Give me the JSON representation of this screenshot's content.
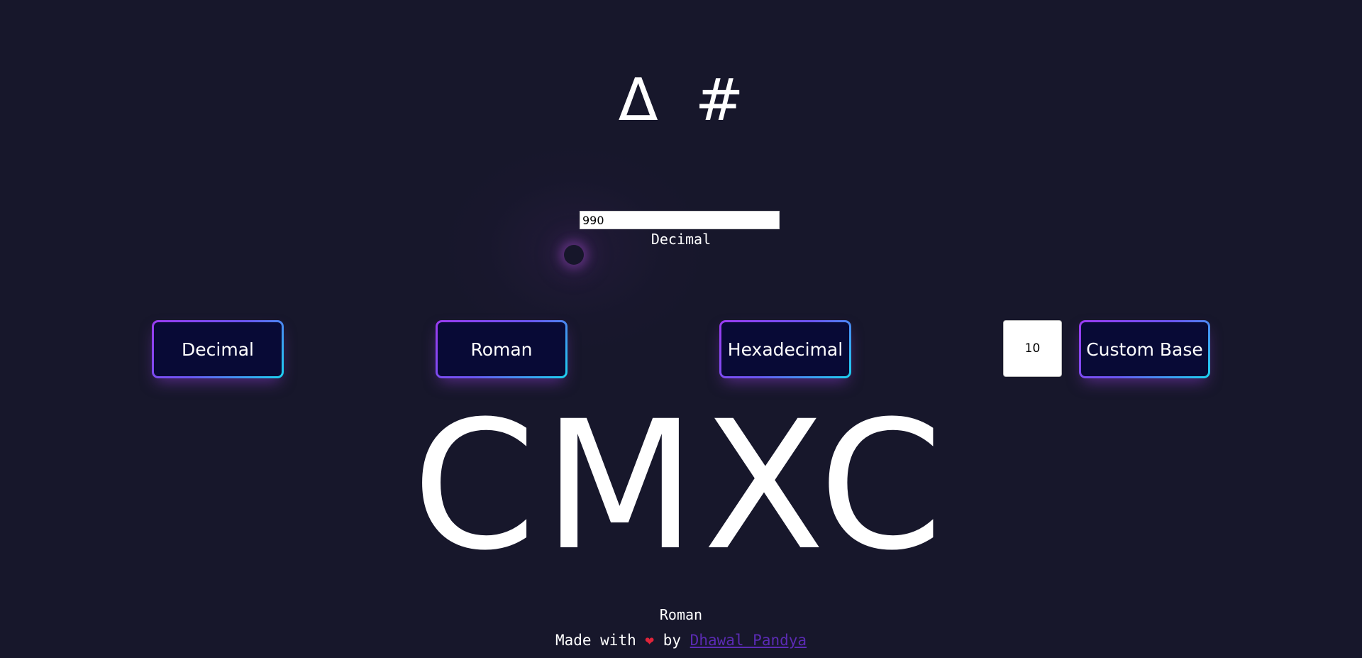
{
  "logo": {
    "delta_symbol": "Δ",
    "hash_symbol": "#"
  },
  "input": {
    "value": "990",
    "type_label": "Decimal"
  },
  "buttons": {
    "decimal": "Decimal",
    "roman": "Roman",
    "hexadecimal": "Hexadecimal",
    "custom_base": "Custom Base"
  },
  "custom_base_input": {
    "value": "10"
  },
  "result": {
    "value": "CMXC",
    "type_label": "Roman"
  },
  "footer": {
    "made_with": "Made with",
    "heart_icon": "heart-icon",
    "by": "by",
    "author_link": "Dhawal Pandya"
  },
  "colors": {
    "background": "#17172b",
    "button_fill": "#080a36",
    "gradient_start": "#9b3bf0",
    "gradient_end": "#1ad3f0",
    "heart": "#e0243a",
    "link": "#5b2bb4"
  }
}
